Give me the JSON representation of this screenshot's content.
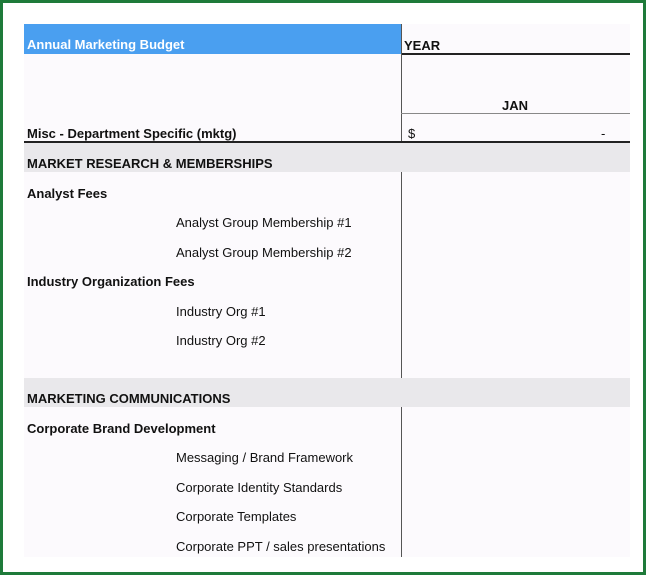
{
  "header": {
    "title": "Annual Marketing Budget",
    "year_label": "YEAR",
    "month_label": "JAN"
  },
  "misc_row": {
    "label": "Misc - Department Specific (mktg)",
    "currency": "$",
    "value": "-"
  },
  "sections": [
    {
      "title": "MARKET RESEARCH & MEMBERSHIPS",
      "groups": [
        {
          "title": "Analyst Fees",
          "items": [
            "Analyst Group Membership #1",
            "Analyst Group Membership #2"
          ]
        },
        {
          "title": "Industry Organization Fees",
          "items": [
            "Industry Org #1",
            "Industry Org #2"
          ]
        }
      ]
    },
    {
      "title": "MARKETING COMMUNICATIONS",
      "groups": [
        {
          "title": "Corporate Brand Development",
          "items": [
            "Messaging / Brand Framework",
            "Corporate Identity Standards",
            "Corporate Templates",
            "Corporate PPT / sales presentations"
          ]
        }
      ]
    }
  ],
  "colors": {
    "title_fill": "#4a9ff0",
    "section_band": "#e9e8eb",
    "frame_border": "#1e7a3a"
  }
}
